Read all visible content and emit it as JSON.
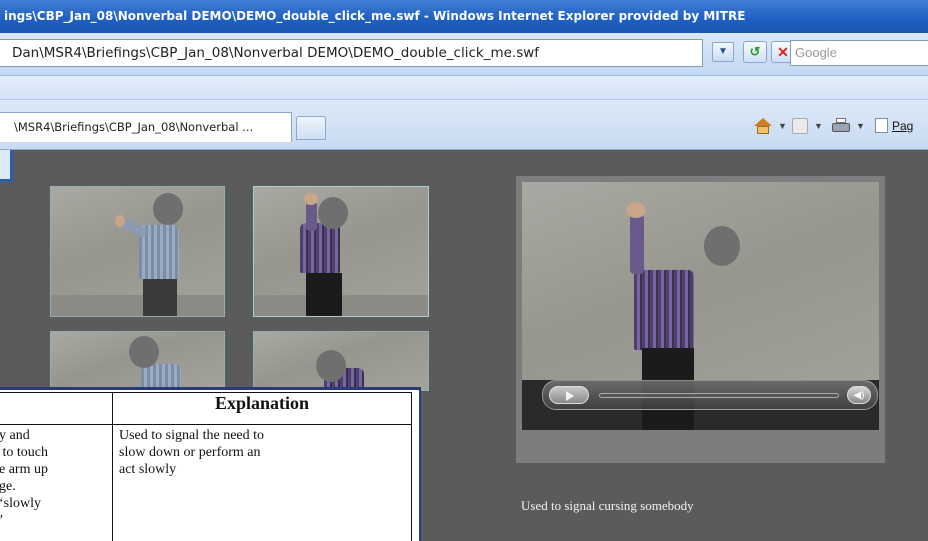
{
  "window": {
    "title": "ings\\CBP_Jan_08\\Nonverbal DEMO\\DEMO_double_click_me.swf - Windows Internet Explorer provided by MITRE"
  },
  "address_bar": {
    "url": "Dan\\MSR4\\Briefings\\CBP_Jan_08\\Nonverbal DEMO\\DEMO_double_click_me.swf",
    "search_placeholder": "Google"
  },
  "tabs": [
    {
      "label": "\\MSR4\\Briefings\\CBP_Jan_08\\Nonverbal ..."
    }
  ],
  "command_bar": {
    "page_label": "Pag"
  },
  "thumbnails": [
    {
      "name": "gesture-1"
    },
    {
      "name": "gesture-2"
    },
    {
      "name": "gesture-3"
    },
    {
      "name": "gesture-4"
    }
  ],
  "player": {
    "caption": "Used to signal cursing somebody"
  },
  "doc_table": {
    "headers": [
      "",
      "Explanation"
    ],
    "rows": [
      {
        "description": "y and\n to touch\ne arm up\nge.\n‘slowly\n’",
        "explanation": "Used to signal the need to\nslow down or perform an\nact slowly"
      }
    ]
  },
  "colors": {
    "titlebar": "#1f5fc0",
    "content_bg": "#5b5b5b",
    "thumb_border": "#8fb3b3"
  }
}
